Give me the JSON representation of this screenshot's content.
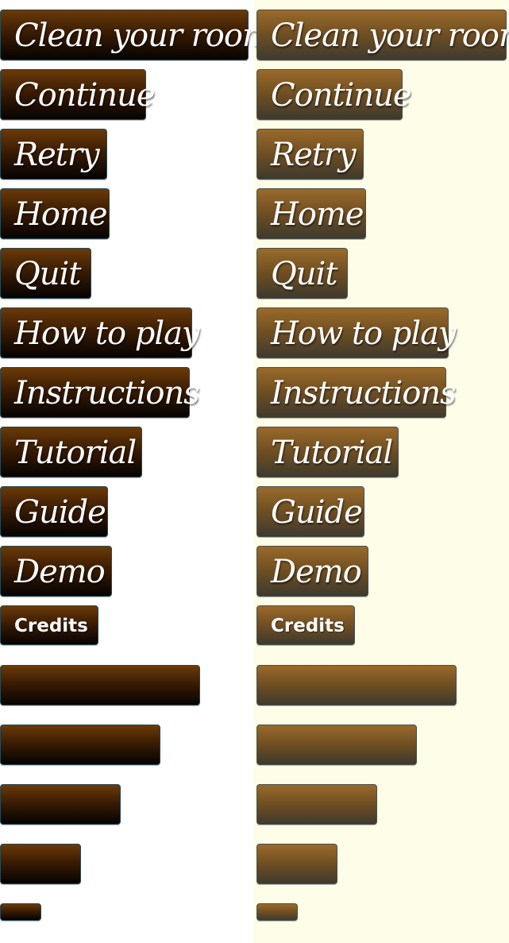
{
  "colors": {
    "right_panel_background": "#fdfde8",
    "left_button_top": "#6b3a08",
    "left_button_bottom": "#050302",
    "right_button_top": "#9a6a2a",
    "right_button_bottom": "#3e3a2e",
    "button_text": "#ffffff"
  },
  "buttons": [
    {
      "label": "Clean your room"
    },
    {
      "label": "Continue"
    },
    {
      "label": "Retry"
    },
    {
      "label": "Home"
    },
    {
      "label": "Quit"
    },
    {
      "label": "How to play"
    },
    {
      "label": "Instructions"
    },
    {
      "label": "Tutorial"
    },
    {
      "label": "Guide"
    },
    {
      "label": "Demo"
    },
    {
      "label": "Credits"
    }
  ]
}
